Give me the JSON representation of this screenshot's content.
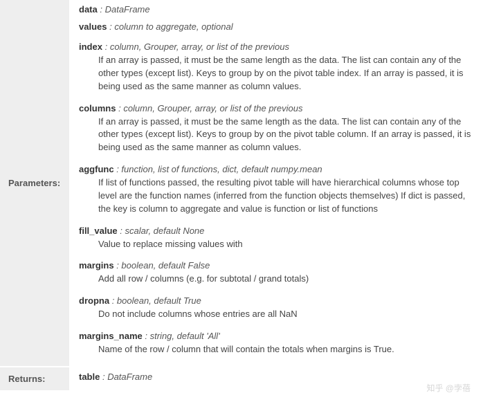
{
  "sections": {
    "parameters": {
      "label": "Parameters:",
      "items": [
        {
          "name": "data",
          "type": ": DataFrame",
          "desc": ""
        },
        {
          "name": "values",
          "type": ": column to aggregate, optional",
          "desc": ""
        },
        {
          "name": "index",
          "type": ": column, Grouper, array, or list of the previous",
          "desc": "If an array is passed, it must be the same length as the data. The list can contain any of the other types (except list). Keys to group by on the pivot table index. If an array is passed, it is being used as the same manner as column values."
        },
        {
          "name": "columns",
          "type": ": column, Grouper, array, or list of the previous",
          "desc": "If an array is passed, it must be the same length as the data. The list can contain any of the other types (except list). Keys to group by on the pivot table column. If an array is passed, it is being used as the same manner as column values."
        },
        {
          "name": "aggfunc",
          "type": ": function, list of functions, dict, default numpy.mean",
          "desc": "If list of functions passed, the resulting pivot table will have hierarchical columns whose top level are the function names (inferred from the function objects themselves) If dict is passed, the key is column to aggregate and value is function or list of functions"
        },
        {
          "name": "fill_value",
          "type": ": scalar, default None",
          "desc": "Value to replace missing values with"
        },
        {
          "name": "margins",
          "type": ": boolean, default False",
          "desc": "Add all row / columns (e.g. for subtotal / grand totals)"
        },
        {
          "name": "dropna",
          "type": ": boolean, default True",
          "desc": "Do not include columns whose entries are all NaN"
        },
        {
          "name": "margins_name",
          "type": ": string, default 'All'",
          "desc": "Name of the row / column that will contain the totals when margins is True."
        }
      ]
    },
    "returns": {
      "label": "Returns:",
      "items": [
        {
          "name": "table",
          "type": ": DataFrame",
          "desc": ""
        }
      ]
    }
  },
  "watermark": "知乎 @孛蓓"
}
